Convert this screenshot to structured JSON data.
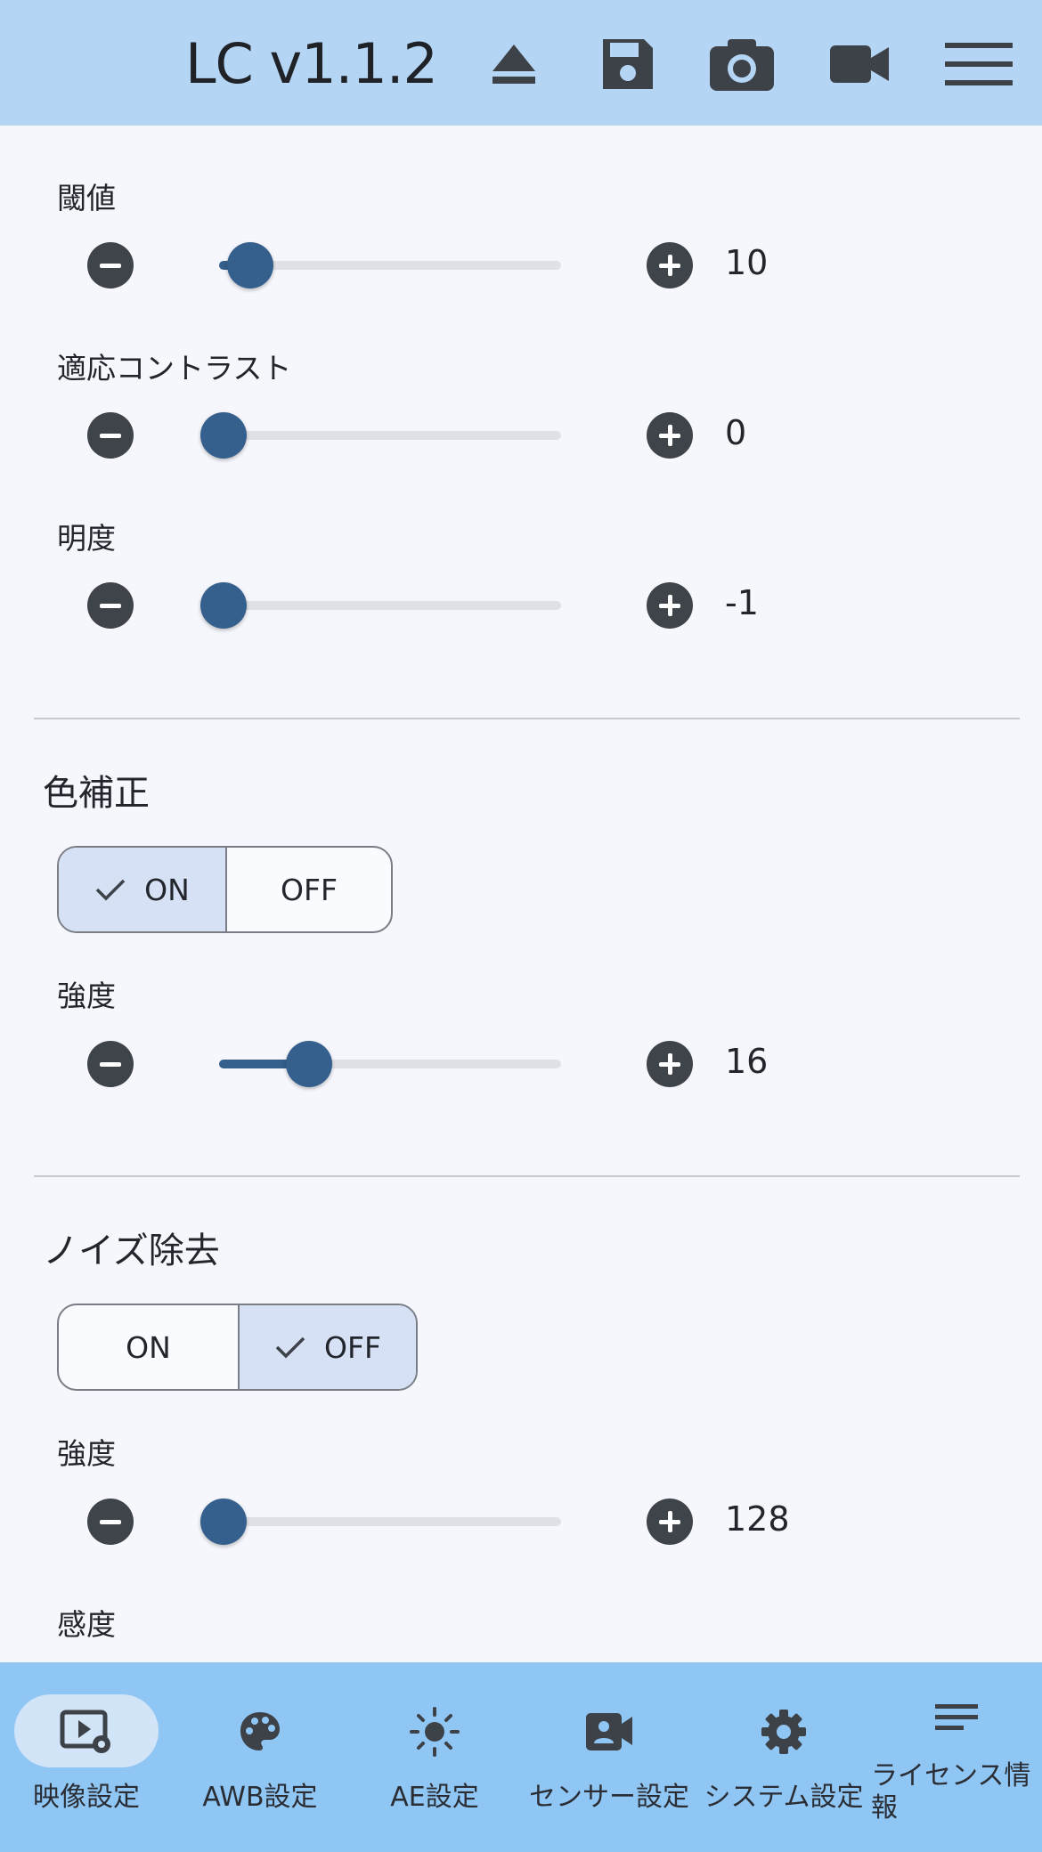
{
  "header": {
    "title": "LC v1.1.2"
  },
  "sliders": {
    "threshold": {
      "label": "閾値",
      "value": "10",
      "level": 0.05
    },
    "adaptive_contrast": {
      "label": "適応コントラスト",
      "value": "0",
      "level": 0.0
    },
    "brightness": {
      "label": "明度",
      "value": "-1",
      "level": 0.0
    },
    "color_strength": {
      "label": "強度",
      "value": "16",
      "level": 0.26
    },
    "noise_strength": {
      "label": "強度",
      "value": "128",
      "level": 0.0
    }
  },
  "color_correction": {
    "title": "色補正",
    "on": "ON",
    "off": "OFF",
    "selected": "ON"
  },
  "noise_reduction": {
    "title": "ノイズ除去",
    "on": "ON",
    "off": "OFF",
    "selected": "OFF"
  },
  "sensitivity": {
    "label": "感度"
  },
  "bottom_nav": [
    {
      "label": "映像設定",
      "icon": "video-settings-icon",
      "active": true
    },
    {
      "label": "AWB設定",
      "icon": "palette-icon",
      "active": false
    },
    {
      "label": "AE設定",
      "icon": "sun-icon",
      "active": false
    },
    {
      "label": "センサー設定",
      "icon": "camera-person-icon",
      "active": false
    },
    {
      "label": "システム設定",
      "icon": "gear-icon",
      "active": false
    },
    {
      "label": "ライセンス情報",
      "icon": "text-lines-icon",
      "active": false
    }
  ],
  "colors": {
    "header_bg": "#b4d5f3",
    "nav_bg": "#90c6f4",
    "accent": "#355f8c",
    "selected": "#d6e1f5"
  }
}
